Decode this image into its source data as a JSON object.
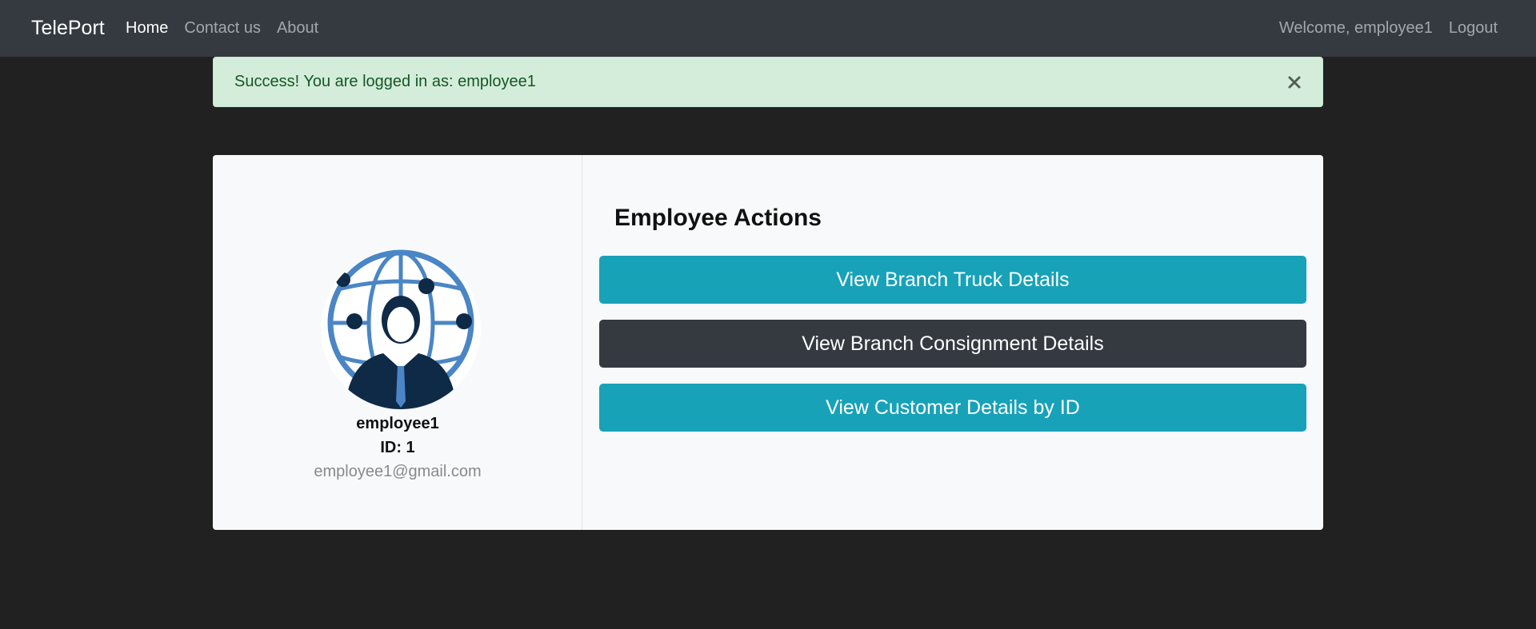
{
  "navbar": {
    "brand": "TelePort",
    "links": [
      {
        "label": "Home",
        "active": true
      },
      {
        "label": "Contact us",
        "active": false
      },
      {
        "label": "About",
        "active": false
      }
    ],
    "welcome": "Welcome, employee1",
    "logout": "Logout"
  },
  "alert": {
    "message": "Success! You are logged in as: employee1"
  },
  "profile": {
    "name": "employee1",
    "id": "ID: 1",
    "email": "employee1@gmail.com"
  },
  "actions": {
    "title": "Employee Actions",
    "buttons": [
      {
        "label": "View Branch Truck Details"
      },
      {
        "label": "View Branch Consignment Details"
      },
      {
        "label": "View Customer Details by ID"
      }
    ]
  },
  "colors": {
    "navbar_bg": "#343a40",
    "page_bg": "#212121",
    "alert_bg": "#d4edda",
    "alert_text": "#155724",
    "info": "#17a2b8",
    "dark": "#343a40"
  }
}
